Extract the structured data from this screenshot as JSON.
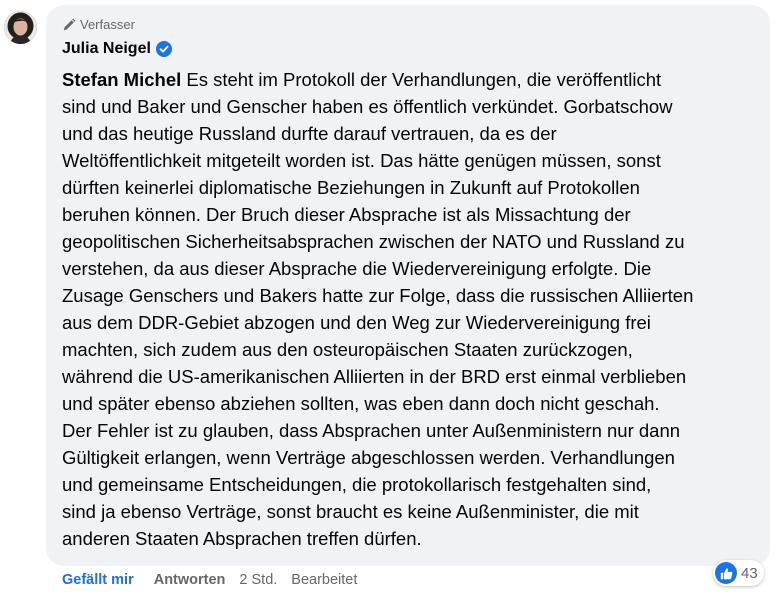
{
  "comment": {
    "author_badge": "Verfasser",
    "author_name": "Julia Neigel",
    "mention": "Stefan Michel",
    "text": " Es steht im Protokoll der Verhandlungen, die veröffentlicht\nsind und Baker und Genscher haben es öffentlich verkündet. Gorbatschow\nund das heutige Russland durfte darauf vertrauen, da es der\nWeltöffentlichkeit mitgeteilt worden ist. Das hätte genügen müssen, sonst\ndürften keinerlei diplomatische Beziehungen in Zukunft auf Protokollen\nberuhen können. Der Bruch dieser Absprache ist als Missachtung der\ngeopolitischen Sicherheitsabsprachen zwischen der NATO und Russland zu\nverstehen, da aus dieser Absprache die Wiedervereinigung erfolgte. Die\nZusage Genschers und Bakers hatte zur Folge, dass die russischen Alliierten\naus dem DDR-Gebiet abzogen und den Weg zur Wiedervereinigung frei\nmachten, sich zudem aus den osteuropäischen Staaten zurückzogen,\nwährend die US-amerikanischen Alliierten in der BRD erst einmal verblieben\nund später ebenso abziehen sollten, was eben dann doch nicht geschah.\nDer Fehler ist zu glauben, dass Absprachen unter Außenministern nur dann\nGültigkeit erlangen, wenn Verträge abgeschlossen werden. Verhandlungen\nund gemeinsame Entscheidungen, die protokollarisch festgehalten sind,\nsind ja ebenso Verträge, sonst braucht es keine Außenminister, die mit\nanderen Staaten Absprachen treffen dürfen.",
    "reaction_icon": "like-icon",
    "reaction_count": "43"
  },
  "actions": {
    "like_label": "Gefällt mir",
    "reply_label": "Antworten",
    "time": "2 Std.",
    "edited": "Bearbeitet"
  },
  "colors": {
    "bubble": "#f0f2f5",
    "like_blue": "#1b74e4",
    "link_blue": "#216fdb",
    "secondary_text": "#65676b"
  }
}
